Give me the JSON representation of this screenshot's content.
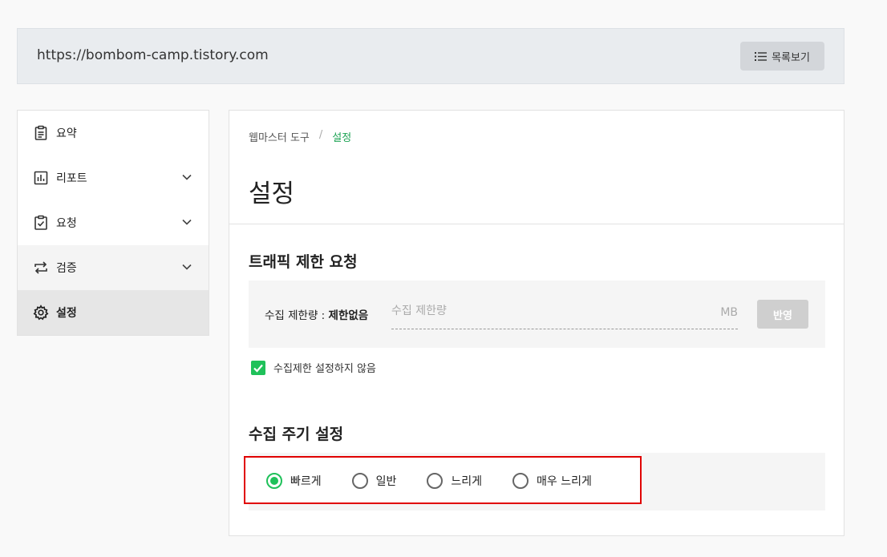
{
  "site": {
    "url": "https://bombom-camp.tistory.com",
    "list_button_label": "목록보기",
    "list_icon": "list-icon"
  },
  "sidebar": {
    "items": [
      {
        "label": "요약",
        "icon": "clipboard-icon",
        "has_chevron": false
      },
      {
        "label": "리포트",
        "icon": "bar-chart-icon",
        "has_chevron": true
      },
      {
        "label": "요청",
        "icon": "clipboard-check-icon",
        "has_chevron": true
      },
      {
        "label": "검증",
        "icon": "repeat-icon",
        "has_chevron": true
      },
      {
        "label": "설정",
        "icon": "gear-icon",
        "has_chevron": false,
        "active": true
      }
    ]
  },
  "main": {
    "breadcrumb": [
      "웹마스터 도구",
      "설정"
    ],
    "breadcrumb_separator": "/",
    "title": "설정",
    "traffic": {
      "title": "트래픽 제한 요청",
      "limit_label_prefix": "수집 제한량 : ",
      "limit_label_value": "제한없음",
      "input_placeholder": "수집 제한량",
      "input_value": "",
      "unit": "MB",
      "apply_label": "반영",
      "checkbox_label": "수집제한 설정하지 않음",
      "checkbox_checked": true
    },
    "crawl": {
      "title": "수집 주기 설정",
      "options": [
        "빠르게",
        "일반",
        "느리게",
        "매우 느리게"
      ],
      "selected_index": 0
    }
  },
  "colors": {
    "accent": "#1fc15a",
    "breadcrumb_current": "#1da354",
    "highlight_border": "#e00000"
  }
}
